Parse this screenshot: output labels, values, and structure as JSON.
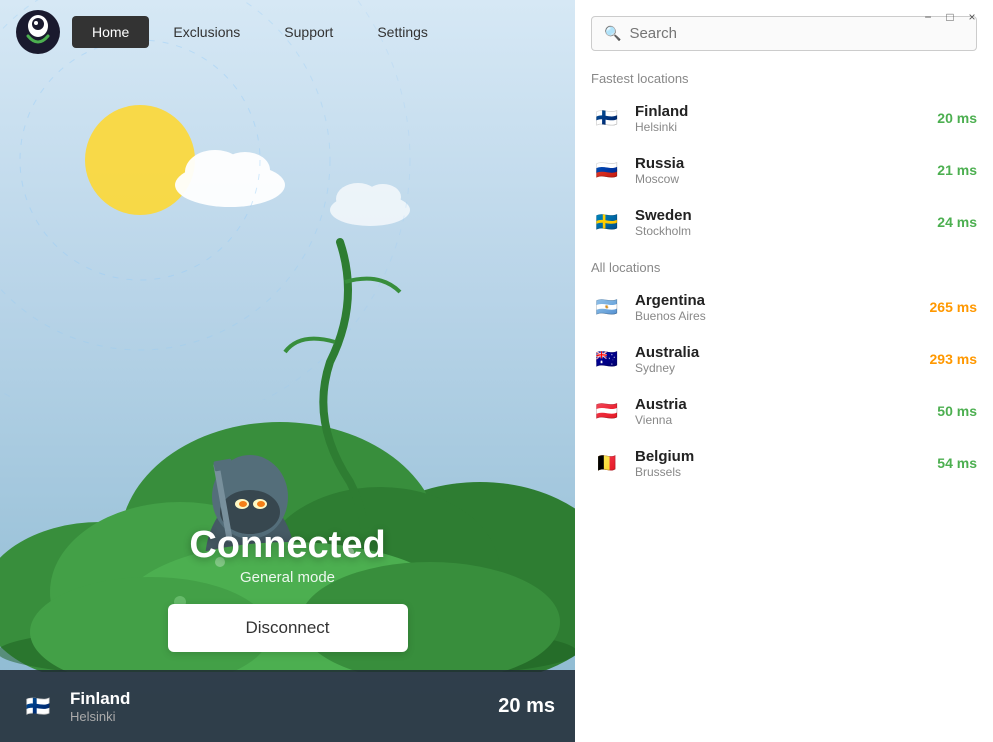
{
  "window": {
    "minimize_label": "−",
    "maximize_label": "□",
    "close_label": "×"
  },
  "nav": {
    "logo_alt": "Windscribe logo",
    "items": [
      {
        "id": "home",
        "label": "Home",
        "active": true
      },
      {
        "id": "exclusions",
        "label": "Exclusions",
        "active": false
      },
      {
        "id": "support",
        "label": "Support",
        "active": false
      },
      {
        "id": "settings",
        "label": "Settings",
        "active": false
      }
    ]
  },
  "status": {
    "text": "Connected",
    "mode": "General mode",
    "disconnect_label": "Disconnect"
  },
  "bottom_bar": {
    "country": "Finland",
    "city": "Helsinki",
    "ms": "20 ms",
    "flag_emoji": "🇫🇮"
  },
  "search": {
    "placeholder": "Search",
    "icon": "🔍"
  },
  "sections": {
    "fastest": "Fastest locations",
    "all": "All locations"
  },
  "fastest_locations": [
    {
      "country": "Finland",
      "city": "Helsinki",
      "ms": "20 ms",
      "ms_class": "ms-fast",
      "flag": "🇫🇮"
    },
    {
      "country": "Russia",
      "city": "Moscow",
      "ms": "21 ms",
      "ms_class": "ms-fast",
      "flag": "🇷🇺"
    },
    {
      "country": "Sweden",
      "city": "Stockholm",
      "ms": "24 ms",
      "ms_class": "ms-fast",
      "flag": "🇸🇪"
    }
  ],
  "all_locations": [
    {
      "country": "Argentina",
      "city": "Buenos Aires",
      "ms": "265 ms",
      "ms_class": "ms-medium",
      "flag": "🇦🇷"
    },
    {
      "country": "Australia",
      "city": "Sydney",
      "ms": "293 ms",
      "ms_class": "ms-medium",
      "flag": "🇦🇺"
    },
    {
      "country": "Austria",
      "city": "Vienna",
      "ms": "50 ms",
      "ms_class": "ms-fast",
      "flag": "🇦🇹"
    },
    {
      "country": "Belgium",
      "city": "Brussels",
      "ms": "54 ms",
      "ms_class": "ms-fast",
      "flag": "🇧🇪"
    }
  ],
  "colors": {
    "accent_green": "#4caf50",
    "accent_orange": "#ff9800",
    "nav_active_bg": "#333333"
  }
}
